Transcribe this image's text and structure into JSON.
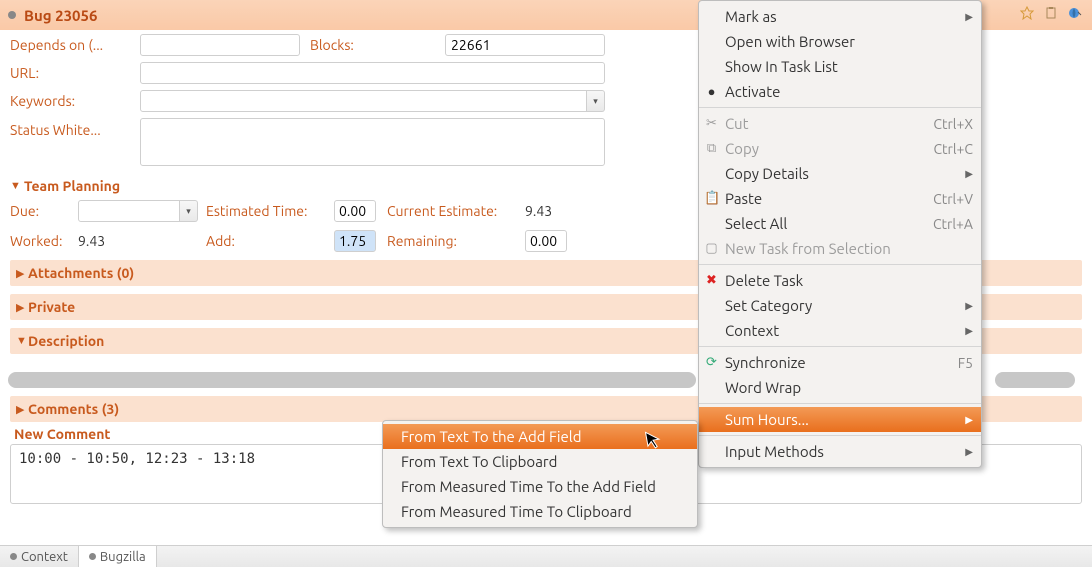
{
  "titlebar": {
    "title": "Bug 23056"
  },
  "form": {
    "depends_on": {
      "label": "Depends on (...",
      "value": ""
    },
    "blocks": {
      "label": "Blocks:",
      "value": "22661"
    },
    "url": {
      "label": "URL:",
      "value": ""
    },
    "keywords": {
      "label": "Keywords:",
      "value": ""
    },
    "status_white": {
      "label": "Status White..."
    }
  },
  "team": {
    "section": "Team Planning",
    "due_label": "Due:",
    "due_value": "",
    "estimated_label": "Estimated Time:",
    "estimated_value": "0.00",
    "current_est_label": "Current Estimate:",
    "current_est_value": "9.43",
    "worked_label": "Worked:",
    "worked_value": "9.43",
    "add_label": "Add:",
    "add_value": "1.75",
    "remaining_label": "Remaining:",
    "remaining_value": "0.00"
  },
  "sections": {
    "attachments": "Attachments (0)",
    "private": "Private",
    "description": "Description",
    "comments": "Comments (3)"
  },
  "comment": {
    "new_label": "New Comment",
    "text": "10:00 - 10:50, 12:23 - 13:18"
  },
  "tabs": {
    "context": "Context",
    "bugzilla": "Bugzilla"
  },
  "ctx_main": {
    "mark_as": "Mark as",
    "open_browser": "Open with Browser",
    "show_task_list": "Show In Task List",
    "activate": "Activate",
    "cut": "Cut",
    "cut_accel": "Ctrl+X",
    "copy": "Copy",
    "copy_accel": "Ctrl+C",
    "copy_details": "Copy Details",
    "paste": "Paste",
    "paste_accel": "Ctrl+V",
    "select_all": "Select All",
    "select_all_accel": "Ctrl+A",
    "new_task_sel": "New Task from Selection",
    "delete_task": "Delete Task",
    "set_category": "Set Category",
    "context": "Context",
    "synchronize": "Synchronize",
    "sync_accel": "F5",
    "word_wrap": "Word Wrap",
    "sum_hours": "Sum Hours...",
    "input_methods": "Input Methods"
  },
  "ctx_sub": {
    "text_to_add": "From Text To the Add Field",
    "text_to_clip": "From Text To Clipboard",
    "meas_to_add": "From Measured Time To the Add Field",
    "meas_to_clip": "From Measured Time To Clipboard"
  }
}
